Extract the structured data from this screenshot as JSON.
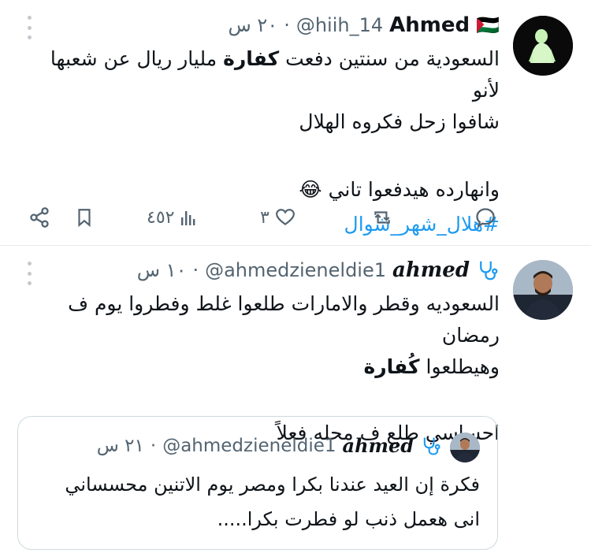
{
  "tweets": [
    {
      "name": "Ahmed",
      "flag_emoji": "🇵🇸",
      "handle": "@hiih_14",
      "time": "٢٠ س",
      "body_line1_before": "السعودية من سنتين دفعت ",
      "body_line1_bold": "كفارة",
      "body_line1_after": " مليار ريال عن شعبها لأنو",
      "body_line2": "شافوا زحل فكروه الهلال",
      "body_line3": "وانهارده  هيدفعوا تاني 😂",
      "hashtag": "#هلال_شهر_شوال",
      "views": "٤٥٢",
      "likes": "٣"
    },
    {
      "name": "ahmed",
      "handle": "@ahmedzieneldie1",
      "time": "١٠ س",
      "body_line1": "السعوديه وقطر والامارات طلعوا غلط وفطروا يوم ف رمضان",
      "body_line2_before": "وهيطلعوا ",
      "body_line2_bold": "كُفارة",
      "body_line3": "احساسي طلع ف محله فعلاً",
      "quote": {
        "name": "ahmed",
        "handle": "@ahmedzieneldie1",
        "time": "٢١ س",
        "line1": "فكرة إن العيد عندنا بكرا ومصر يوم الاتنين محسساني",
        "line2": "انى هعمل ذنب لو فطرت بكرا....."
      }
    }
  ],
  "separator_dot": "·",
  "icons": {
    "share": "share-icon",
    "bookmark": "bookmark-icon",
    "views": "views-chart-icon",
    "like": "heart-icon",
    "retweet": "retweet-icon",
    "reply": "reply-icon",
    "badge": "stethoscope-icon",
    "more": "more-vertical-icon"
  },
  "colors": {
    "text": "#0f1419",
    "muted": "#536471",
    "link": "#1d9bf0",
    "badge": "#1d9bf0"
  }
}
